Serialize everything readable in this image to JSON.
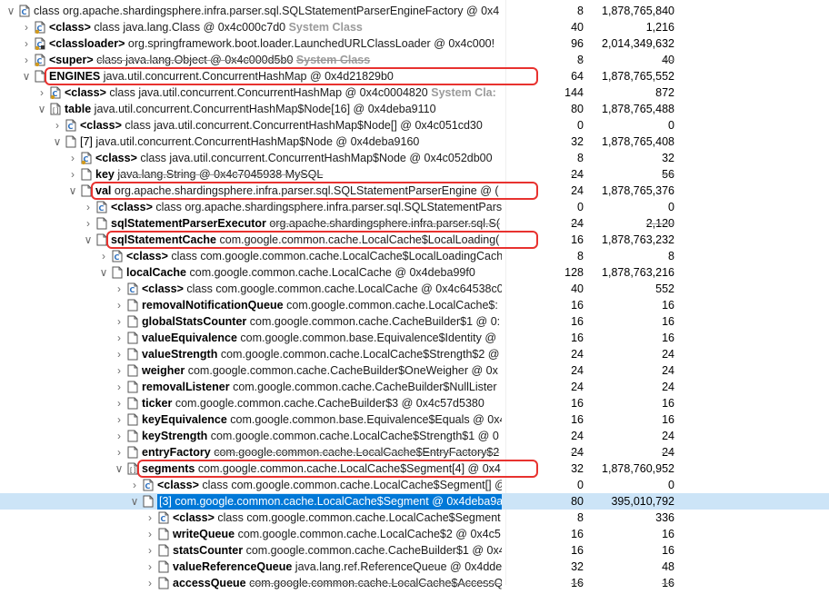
{
  "rows": [
    {
      "indent": 0,
      "tw": "expanded",
      "icon": "class",
      "name": "",
      "type": "class org.apache.shardingsphere.infra.parser.sql.SQLStatementParserEngineFactory @ 0x4",
      "suffix": "",
      "shallow": "8",
      "retained": "1,878,765,840"
    },
    {
      "indent": 1,
      "tw": "collapsed",
      "icon": "class-static",
      "name": "<class>",
      "type": "class java.lang.Class @ 0x4c000c7d0",
      "suffix": "System Class",
      "shallow": "40",
      "retained": "1,216"
    },
    {
      "indent": 1,
      "tw": "collapsed",
      "icon": "loader",
      "name": "<classloader>",
      "type": "org.springframework.boot.loader.LaunchedURLClassLoader @ 0x4c000!",
      "suffix": "",
      "shallow": "96",
      "retained": "2,014,349,632"
    },
    {
      "indent": 1,
      "tw": "collapsed",
      "icon": "class-static",
      "name": "<super>",
      "type": "class java.lang.Object @ 0x4c000d5b0",
      "suffix": "System Class",
      "shallow": "8",
      "retained": "40",
      "strike": true
    },
    {
      "indent": 1,
      "tw": "expanded",
      "icon": "field",
      "name": "ENGINES",
      "type": "java.util.concurrent.ConcurrentHashMap @ 0x4d21829b0",
      "suffix": "",
      "shallow": "64",
      "retained": "1,878,765,552"
    },
    {
      "indent": 2,
      "tw": "collapsed",
      "icon": "class-static",
      "name": "<class>",
      "type": "class java.util.concurrent.ConcurrentHashMap @ 0x4c0004820",
      "suffix": "System Cla:",
      "shallow": "144",
      "retained": "872"
    },
    {
      "indent": 2,
      "tw": "expanded",
      "icon": "array",
      "name": "table",
      "type": "java.util.concurrent.ConcurrentHashMap$Node[16] @ 0x4deba9110",
      "suffix": "",
      "shallow": "80",
      "retained": "1,878,765,488"
    },
    {
      "indent": 3,
      "tw": "collapsed",
      "icon": "class",
      "name": "<class>",
      "type": "class java.util.concurrent.ConcurrentHashMap$Node[] @ 0x4c051cd30",
      "suffix": "",
      "shallow": "0",
      "retained": "0"
    },
    {
      "indent": 3,
      "tw": "expanded",
      "icon": "field",
      "name": "[7]",
      "type": "java.util.concurrent.ConcurrentHashMap$Node @ 0x4deba9160",
      "suffix": "",
      "shallow": "32",
      "retained": "1,878,765,408",
      "plainName": true
    },
    {
      "indent": 4,
      "tw": "collapsed",
      "icon": "class-static",
      "name": "<class>",
      "type": "class java.util.concurrent.ConcurrentHashMap$Node @ 0x4c052db00",
      "suffix": "",
      "shallow": "8",
      "retained": "32"
    },
    {
      "indent": 4,
      "tw": "collapsed",
      "icon": "field",
      "name": "key",
      "type": "java.lang.String @ 0x4c7045938  MySQL",
      "suffix": "",
      "shallow": "24",
      "retained": "56",
      "strike": true
    },
    {
      "indent": 4,
      "tw": "expanded",
      "icon": "field",
      "name": "val",
      "type": "org.apache.shardingsphere.infra.parser.sql.SQLStatementParserEngine @ (",
      "suffix": "",
      "shallow": "24",
      "retained": "1,878,765,376"
    },
    {
      "indent": 5,
      "tw": "collapsed",
      "icon": "class",
      "name": "<class>",
      "type": "class org.apache.shardingsphere.infra.parser.sql.SQLStatementPars",
      "suffix": "",
      "shallow": "0",
      "retained": "0"
    },
    {
      "indent": 5,
      "tw": "collapsed",
      "icon": "field",
      "name": "sqlStatementParserExecutor",
      "type": "org.apache.shardingsphere.infra.parser.sql.S(",
      "suffix": "",
      "shallow": "24",
      "retained": "2,120",
      "strike": true
    },
    {
      "indent": 5,
      "tw": "expanded",
      "icon": "field",
      "name": "sqlStatementCache",
      "type": "com.google.common.cache.LocalCache$LocalLoading(",
      "suffix": "",
      "shallow": "16",
      "retained": "1,878,763,232"
    },
    {
      "indent": 6,
      "tw": "collapsed",
      "icon": "class",
      "name": "<class>",
      "type": "class com.google.common.cache.LocalCache$LocalLoadingCach",
      "suffix": "",
      "shallow": "8",
      "retained": "8"
    },
    {
      "indent": 6,
      "tw": "expanded",
      "icon": "field",
      "name": "localCache",
      "type": "com.google.common.cache.LocalCache @ 0x4deba99f0",
      "suffix": "",
      "shallow": "128",
      "retained": "1,878,763,216"
    },
    {
      "indent": 7,
      "tw": "collapsed",
      "icon": "class",
      "name": "<class>",
      "type": "class com.google.common.cache.LocalCache @ 0x4c64538c0",
      "suffix": "",
      "shallow": "40",
      "retained": "552"
    },
    {
      "indent": 7,
      "tw": "collapsed",
      "icon": "field",
      "name": "removalNotificationQueue",
      "type": "com.google.common.cache.LocalCache$:",
      "suffix": "",
      "shallow": "16",
      "retained": "16"
    },
    {
      "indent": 7,
      "tw": "collapsed",
      "icon": "field",
      "name": "globalStatsCounter",
      "type": "com.google.common.cache.CacheBuilder$1 @ 0:",
      "suffix": "",
      "shallow": "16",
      "retained": "16"
    },
    {
      "indent": 7,
      "tw": "collapsed",
      "icon": "field",
      "name": "valueEquivalence",
      "type": "com.google.common.base.Equivalence$Identity @",
      "suffix": "",
      "shallow": "16",
      "retained": "16"
    },
    {
      "indent": 7,
      "tw": "collapsed",
      "icon": "field",
      "name": "valueStrength",
      "type": "com.google.common.cache.LocalCache$Strength$2 @",
      "suffix": "",
      "shallow": "24",
      "retained": "24"
    },
    {
      "indent": 7,
      "tw": "collapsed",
      "icon": "field",
      "name": "weigher",
      "type": "com.google.common.cache.CacheBuilder$OneWeigher @ 0x",
      "suffix": "",
      "shallow": "24",
      "retained": "24"
    },
    {
      "indent": 7,
      "tw": "collapsed",
      "icon": "field",
      "name": "removalListener",
      "type": "com.google.common.cache.CacheBuilder$NullLister",
      "suffix": "",
      "shallow": "24",
      "retained": "24"
    },
    {
      "indent": 7,
      "tw": "collapsed",
      "icon": "field",
      "name": "ticker",
      "type": "com.google.common.cache.CacheBuilder$3 @ 0x4c57d5380",
      "suffix": "",
      "shallow": "16",
      "retained": "16"
    },
    {
      "indent": 7,
      "tw": "collapsed",
      "icon": "field",
      "name": "keyEquivalence",
      "type": "com.google.common.base.Equivalence$Equals @ 0x4",
      "suffix": "",
      "shallow": "16",
      "retained": "16"
    },
    {
      "indent": 7,
      "tw": "collapsed",
      "icon": "field",
      "name": "keyStrength",
      "type": "com.google.common.cache.LocalCache$Strength$1 @ 0",
      "suffix": "",
      "shallow": "24",
      "retained": "24"
    },
    {
      "indent": 7,
      "tw": "collapsed",
      "icon": "field",
      "name": "entryFactory",
      "type": "com.google.common.cache.LocalCache$EntryFactory$2",
      "suffix": "",
      "shallow": "24",
      "retained": "24",
      "strike": true
    },
    {
      "indent": 7,
      "tw": "expanded",
      "icon": "array",
      "name": "segments",
      "type": "com.google.common.cache.LocalCache$Segment[4] @ 0x4",
      "suffix": "",
      "shallow": "32",
      "retained": "1,878,760,952"
    },
    {
      "indent": 8,
      "tw": "collapsed",
      "icon": "class",
      "name": "<class>",
      "type": "class com.google.common.cache.LocalCache$Segment[] @",
      "suffix": "",
      "shallow": "0",
      "retained": "0"
    },
    {
      "indent": 8,
      "tw": "expanded",
      "icon": "field",
      "name": "[3]",
      "type": "com.google.common.cache.LocalCache$Segment @ 0x4deba9a",
      "suffix": "",
      "shallow": "80",
      "retained": "395,010,792",
      "selected": true,
      "plainName": true
    },
    {
      "indent": 9,
      "tw": "collapsed",
      "icon": "class",
      "name": "<class>",
      "type": "class com.google.common.cache.LocalCache$Segment",
      "suffix": "",
      "shallow": "8",
      "retained": "336"
    },
    {
      "indent": 9,
      "tw": "collapsed",
      "icon": "field",
      "name": "writeQueue",
      "type": "com.google.common.cache.LocalCache$2 @ 0x4c5",
      "suffix": "",
      "shallow": "16",
      "retained": "16"
    },
    {
      "indent": 9,
      "tw": "collapsed",
      "icon": "field",
      "name": "statsCounter",
      "type": "com.google.common.cache.CacheBuilder$1 @ 0x4",
      "suffix": "",
      "shallow": "16",
      "retained": "16"
    },
    {
      "indent": 9,
      "tw": "collapsed",
      "icon": "field",
      "name": "valueReferenceQueue",
      "type": "java.lang.ref.ReferenceQueue @ 0x4dde",
      "suffix": "",
      "shallow": "32",
      "retained": "48"
    },
    {
      "indent": 9,
      "tw": "collapsed",
      "icon": "field",
      "name": "accessQueue",
      "type": "com.google.common.cache.LocalCache$AccessQu",
      "suffix": "",
      "shallow": "16",
      "retained": "16",
      "strike": true
    }
  ],
  "highlight_rows": [
    4,
    11,
    14,
    28
  ],
  "colors": {
    "highlight": "#e8322f",
    "selection": "#0078d7",
    "selection_row": "#cce4f7",
    "system_class_text": "#9a9a9a",
    "icon_blue": "#2a6ebd",
    "icon_gold": "#d19a1e"
  }
}
